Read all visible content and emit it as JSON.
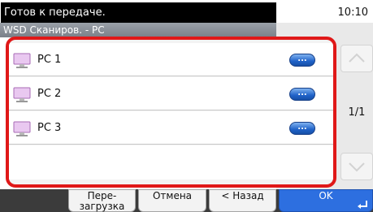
{
  "status": {
    "message": "Готов к передаче.",
    "time": "10:10"
  },
  "title": "WSD Сканиров. - PC",
  "list": [
    {
      "label": "PC 1",
      "icon": "computer-icon",
      "action_icon": "ellipsis-icon",
      "action_label": "..."
    },
    {
      "label": "PC 2",
      "icon": "computer-icon",
      "action_icon": "ellipsis-icon",
      "action_label": "..."
    },
    {
      "label": "PC 3",
      "icon": "computer-icon",
      "action_icon": "ellipsis-icon",
      "action_label": "..."
    }
  ],
  "pager": {
    "indicator": "1/1",
    "up_icon": "chevron-up-icon",
    "down_icon": "chevron-down-icon"
  },
  "softkeys": {
    "reload_line1": "Пере-",
    "reload_line2": "загрузка",
    "cancel": "Отмена",
    "back": "< Назад",
    "ok": "OK",
    "ok_icon": "enter-arrow-icon"
  },
  "colors": {
    "highlight_border": "#e01818",
    "ok_button": "#2d6fe0",
    "action_button": "#1f62c8"
  }
}
